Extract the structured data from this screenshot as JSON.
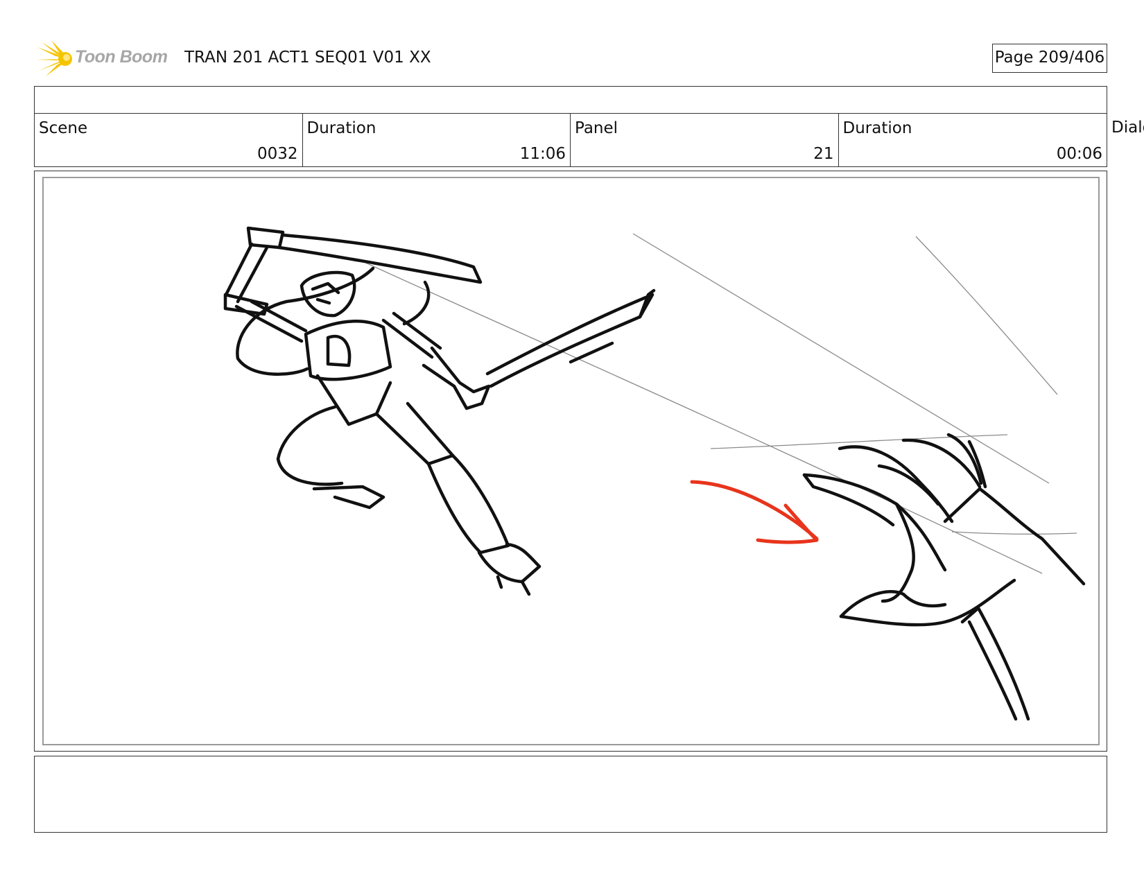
{
  "header": {
    "logo_text": "Toon Boom",
    "logo_color": "#f5c400",
    "title": "TRAN 201 ACT1 SEQ01 V01 XX",
    "page": "Page 209/406"
  },
  "info": {
    "scene_label": "Scene",
    "scene_value": "0032",
    "scene_duration_label": "Duration",
    "scene_duration_value": "11:06",
    "panel_label": "Panel",
    "panel_value": "21",
    "panel_duration_label": "Duration",
    "panel_duration_value": "00:06",
    "dialog_label": "Dialo"
  },
  "panel": {
    "sketch_ink": "#111111",
    "accent_arrow_color": "#e8341c",
    "icons": [
      "sword-robot-sketch",
      "reaching-hand-sketch",
      "motion-arrow"
    ]
  }
}
